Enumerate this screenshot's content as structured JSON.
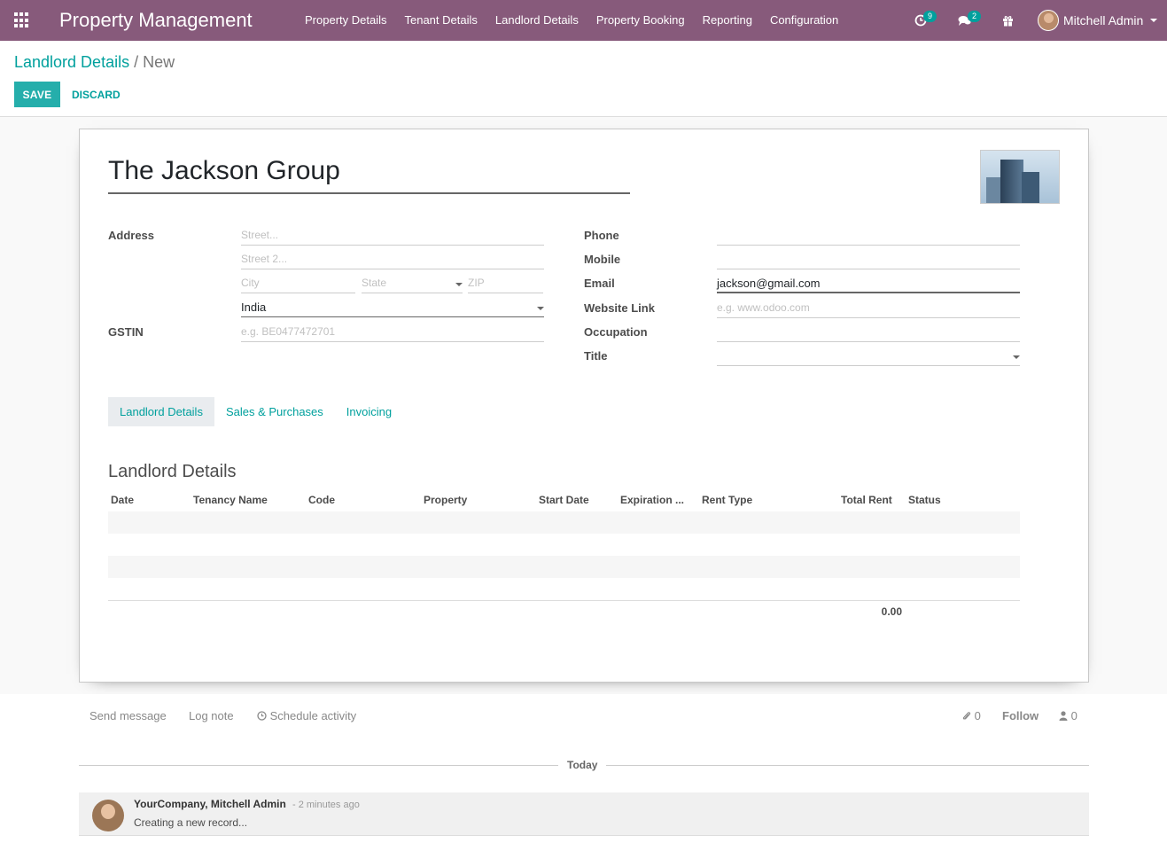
{
  "navbar": {
    "brand": "Property Management",
    "menu": [
      "Property Details",
      "Tenant Details",
      "Landlord Details",
      "Property Booking",
      "Reporting",
      "Configuration"
    ],
    "activity_count": "9",
    "message_count": "2",
    "user": "Mitchell Admin",
    "accent_color": "#875a7b"
  },
  "control_panel": {
    "breadcrumb_parent": "Landlord Details",
    "breadcrumb_separator": "/",
    "breadcrumb_current": "New",
    "save_label": "SAVE",
    "discard_label": "DISCARD"
  },
  "form": {
    "name": "The Jackson Group",
    "address_label": "Address",
    "street_placeholder": "Street...",
    "street2_placeholder": "Street 2...",
    "city_placeholder": "City",
    "state_placeholder": "State",
    "zip_placeholder": "ZIP",
    "country": "India",
    "gstin_label": "GSTIN",
    "gstin_placeholder": "e.g. BE0477472701",
    "phone_label": "Phone",
    "phone_value": "",
    "mobile_label": "Mobile",
    "mobile_value": "",
    "email_label": "Email",
    "email_value": "jackson@gmail.com",
    "website_label": "Website Link",
    "website_placeholder": "e.g. www.odoo.com",
    "occupation_label": "Occupation",
    "occupation_value": "",
    "title_label": "Title",
    "title_value": ""
  },
  "tabs": [
    "Landlord Details",
    "Sales & Purchases",
    "Invoicing"
  ],
  "landlord_section": {
    "title": "Landlord Details",
    "columns": [
      "Date",
      "Tenancy Name",
      "Code",
      "Property",
      "Start Date",
      "Expiration ...",
      "Rent Type",
      "Total Rent",
      "Status"
    ],
    "rows": [],
    "total": "0.00"
  },
  "chatter": {
    "send_message": "Send message",
    "log_note": "Log note",
    "schedule_activity": "Schedule activity",
    "attachments_count": "0",
    "follow": "Follow",
    "followers_count": "0",
    "today": "Today",
    "message_author": "YourCompany, Mitchell Admin",
    "message_time": "- 2 minutes ago",
    "message_body": "Creating a new record..."
  }
}
